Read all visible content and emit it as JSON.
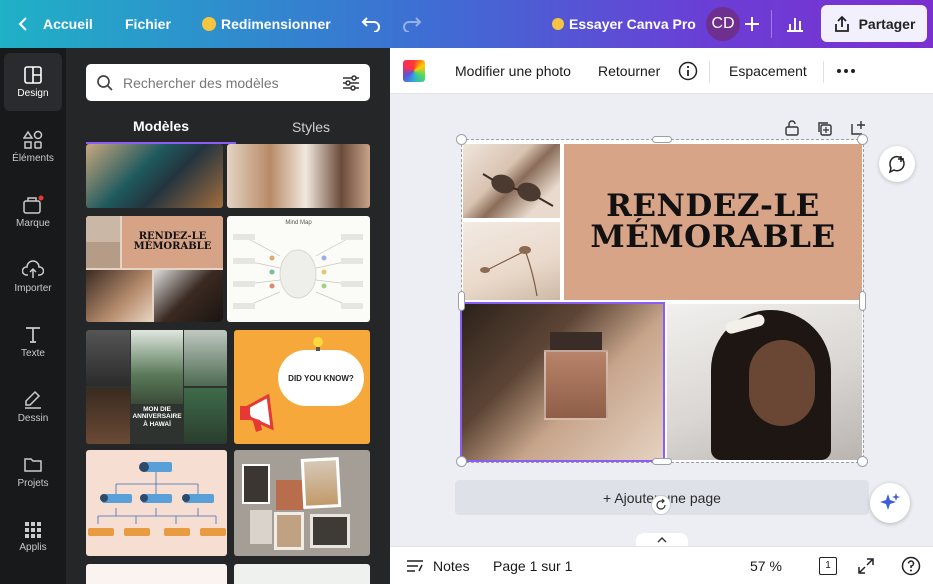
{
  "topbar": {
    "home_label": "Accueil",
    "file_label": "Fichier",
    "resize_label": "Redimensionner",
    "try_pro_label": "Essayer Canva Pro",
    "avatar_initials": "CD",
    "share_label": "Partager"
  },
  "rail": {
    "items": [
      {
        "label": "Design",
        "icon": "layout-icon"
      },
      {
        "label": "Éléments",
        "icon": "shapes-icon"
      },
      {
        "label": "Marque",
        "icon": "brand-icon"
      },
      {
        "label": "Importer",
        "icon": "upload-icon"
      },
      {
        "label": "Texte",
        "icon": "text-icon"
      },
      {
        "label": "Dessin",
        "icon": "draw-icon"
      },
      {
        "label": "Projets",
        "icon": "folder-icon"
      },
      {
        "label": "Applis",
        "icon": "apps-icon"
      }
    ]
  },
  "panel": {
    "search_placeholder": "Rechercher des modèles",
    "tabs": [
      "Modèles",
      "Styles"
    ],
    "templates": {
      "memorable_line1": "RENDEZ-LE",
      "memorable_line2": "MÉMORABLE",
      "mindmap_title": "Mind Map",
      "birthday_line1": "MON DIE",
      "birthday_line2": "ANNIVERSAIRE",
      "birthday_line3": "À HAWAÏ",
      "didyouknow": "DID YOU KNOW?"
    }
  },
  "toolbar": {
    "edit_photo": "Modifier une photo",
    "flip": "Retourner",
    "spacing": "Espacement"
  },
  "design": {
    "line1": "RENDEZ-LE",
    "line2": "MÉMORABLE",
    "add_page": "+ Ajouter une page"
  },
  "bottombar": {
    "notes": "Notes",
    "page_info": "Page 1 sur 1",
    "zoom": "57 %",
    "page_count": "1"
  },
  "colors": {
    "peach": "#d8a488",
    "accent": "#8b5cf6"
  }
}
